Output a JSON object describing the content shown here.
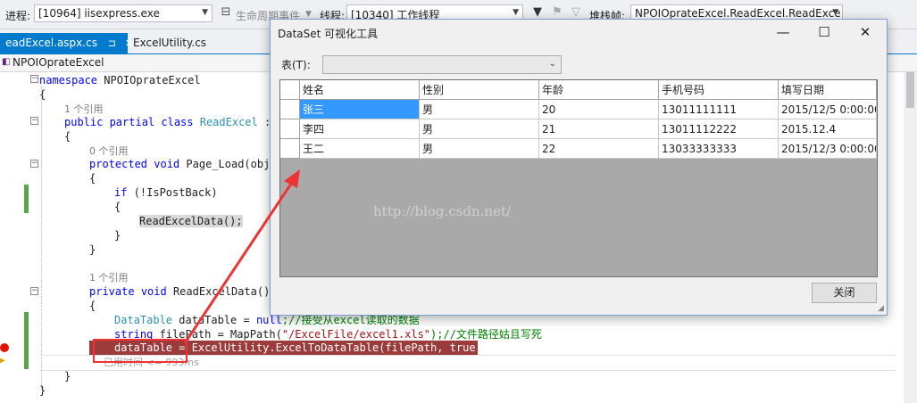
{
  "toolbar": {
    "process_label": "进程:",
    "process_value": "[10964] iisexpress.exe",
    "lifecycle_label": "生命周期事件",
    "thread_label": "线程:",
    "thread_value": "[10340] 工作线程",
    "stackframe_label": "堆栈帧:",
    "stackframe_value": "NPOIOprateExcel.ReadExcel.ReadExce"
  },
  "tabs": [
    {
      "label": "eadExcel.aspx.cs",
      "pin": "⊐",
      "close": "✕"
    },
    {
      "label": "ExcelUtility.cs"
    }
  ],
  "navbar": {
    "label": "NPOIOprateExcel"
  },
  "code": {
    "l1_kw": "namespace",
    "l1_name": " NPOIOprateExcel",
    "brace_open": "{",
    "brace_close": "}",
    "ref1": "1 个引用",
    "l3_kw": "public partial class",
    "l3_name": "ReadExcel",
    "l3_rest": " :",
    "ref0": "0 个引用",
    "l5_kw1": "protected",
    "l5_kw2": "void",
    "l5_rest": " Page_Load(obje",
    "l7_kw": "if",
    "l7_rest": " (!IsPostBack)",
    "l9_call": "ReadExcelData();",
    "ref2": "1 个引用",
    "l13_kw1": "private",
    "l13_kw2": "void",
    "l13_rest": " ReadExcelData()",
    "l15_type": "DataTable",
    "l15_mid": " dataTable = ",
    "l15_kw": "null",
    "l15_cm": ";//接受从excel读取的数据",
    "l16_kw": "string",
    "l16_mid": " filePath = MapPath(",
    "l16_str": "\"/ExcelFile/excel1.xls\"",
    "l16_cm": ");//文件路径姑且写死",
    "l17_text": "dataTable = ExcelUtility.ExcelToDataTable(filePath, true);",
    "l18_text": "已用时间 <= 993ms"
  },
  "dialog": {
    "title": "DataSet 可视化工具",
    "minimize": "—",
    "maximize": "☐",
    "close": "✕",
    "table_label": "表(T):",
    "close_button": "关闭",
    "watermark": "http://blog.csdn.net/",
    "columns": [
      "姓名",
      "性别",
      "年龄",
      "手机号码",
      "填写日期"
    ],
    "rows": [
      [
        "张三",
        "男",
        "20",
        "13011111111",
        "2015/12/5 0:00:00"
      ],
      [
        "李四",
        "男",
        "21",
        "13011112222",
        "2015.12.4"
      ],
      [
        "王二",
        "男",
        "22",
        "13033333333",
        "2015/12/3 0:00:00"
      ]
    ]
  },
  "colors": {
    "accent": "#007acc",
    "selection": "#3399ff",
    "breakpoint": "#e51400",
    "annotation": "#ee3333"
  }
}
